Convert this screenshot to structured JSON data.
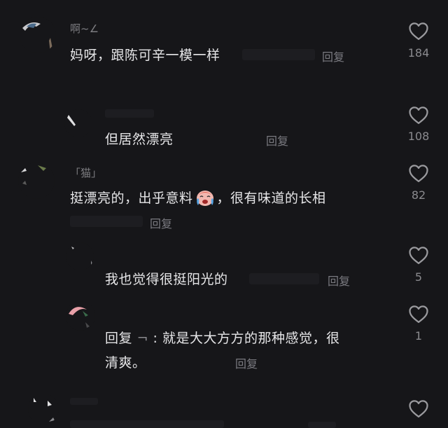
{
  "comments": [
    {
      "username": "啊~∠",
      "text": "妈呀，跟陈可辛一模一样",
      "reply_label": "回复",
      "likes": "184"
    },
    {
      "username": "",
      "text": "但居然漂亮",
      "reply_label": "回复",
      "likes": "108"
    },
    {
      "username": "「猫」",
      "text_before": "挺漂亮的，出乎意料",
      "text_after": "，很有味道的长相",
      "reply_label": "回复",
      "likes": "82"
    },
    {
      "username": "",
      "text": "我也觉得很挺阳光的",
      "reply_label": "回复",
      "likes": "5"
    },
    {
      "username": "",
      "reply_prefix": "回复",
      "reply_target": "¬",
      "text_line1": ":  就是大大方方的那种感觉，很",
      "text_line2": "清爽。",
      "reply_label": "回复",
      "likes": "1"
    },
    {
      "username": "",
      "text": "",
      "reply_label": "",
      "likes": ""
    }
  ],
  "icons": {
    "like": "heart-outline-icon",
    "emoji": "crying-laughing-face-icon"
  },
  "colors": {
    "background": "#161619",
    "text": "#e6e6e8",
    "muted": "#7a7a80"
  }
}
